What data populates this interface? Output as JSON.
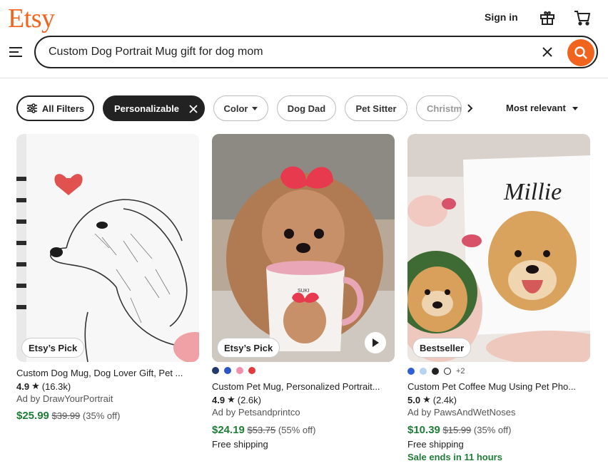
{
  "header": {
    "logo": "Etsy",
    "sign_in": "Sign in",
    "icons": [
      "gift-icon",
      "cart-icon",
      "menu-icon"
    ],
    "search": {
      "value": "Custom Dog Portrait Mug gift for dog mom"
    }
  },
  "filters": {
    "all_filters": "All Filters",
    "chips": [
      "Personalizable",
      "Color",
      "Dog Dad",
      "Pet Sitter",
      "Christmas"
    ],
    "sort": "Most relevant"
  },
  "products": [
    {
      "badge": "Etsy’s Pick",
      "title": "Custom Dog Mug, Dog Lover Gift, Pet ...",
      "rating": "4.9",
      "reviews": "(16.3k)",
      "shop": "Ad by DrawYourPortrait",
      "price": "$25.99",
      "original_price": "$39.99",
      "discount": "(35% off)"
    },
    {
      "badge": "Etsy’s Pick",
      "title": "Custom Pet Mug, Personalized Portrait...",
      "rating": "4.9",
      "reviews": "(2.6k)",
      "shop": "Ad by Petsandprintco",
      "price": "$24.19",
      "original_price": "$53.75",
      "discount": "(55% off)",
      "shipping": "Free shipping",
      "mug_text": "SUKI",
      "swatch_colors": [
        "#1f3a6b",
        "#2a55c9",
        "#f08fae",
        "#e23a3a"
      ]
    },
    {
      "badge": "Bestseller",
      "title": "Custom Pet Coffee Mug Using Pet Pho...",
      "rating": "5.0",
      "reviews": "(2.4k)",
      "shop": "Ad by PawsAndWetNoses",
      "price": "$10.39",
      "original_price": "$15.99",
      "discount": "(35% off)",
      "shipping": "Free shipping",
      "sale": "Sale ends in 11 hours",
      "mug_text": "Millie",
      "swatch_colors": [
        "#2f5fd6",
        "#b6d3f2",
        "#222222",
        "#ffffff"
      ],
      "swatch_more": "+2"
    }
  ],
  "colors": {
    "brand": "#f1641e",
    "price_green": "#1e7d36"
  }
}
